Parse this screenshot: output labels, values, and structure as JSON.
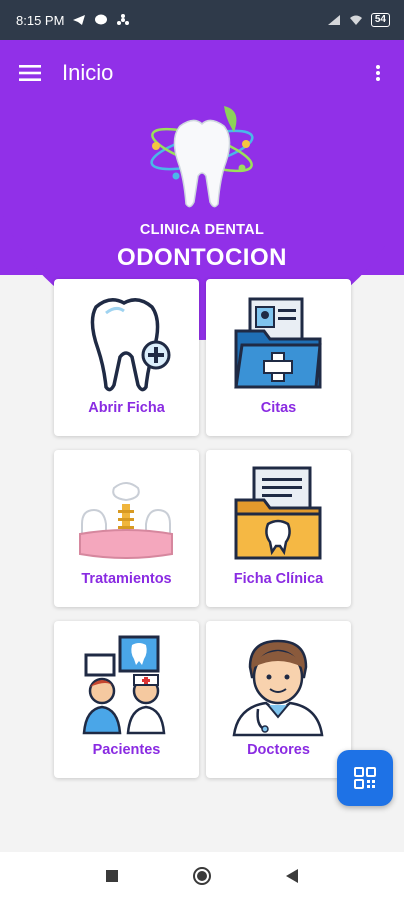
{
  "status_bar": {
    "time": "8:15 PM",
    "battery": "54",
    "icons": [
      "telegram-icon",
      "messenger-icon",
      "fan-icon",
      "signal-icon",
      "wifi-icon",
      "battery-icon"
    ]
  },
  "app_bar": {
    "title": "Inicio",
    "menu_icon": "hamburger-menu-icon",
    "more_icon": "more-vert-icon"
  },
  "clinic": {
    "subtitle": "CLINICA DENTAL",
    "name": "ODONTOCION"
  },
  "menu_cards": [
    {
      "label": "Abrir Ficha",
      "icon": "tooth-add-icon"
    },
    {
      "label": "Citas",
      "icon": "medical-folder-icon"
    },
    {
      "label": "Tratamientos",
      "icon": "dental-implant-icon"
    },
    {
      "label": "Ficha Clínica",
      "icon": "dental-record-folder-icon"
    },
    {
      "label": "Pacientes",
      "icon": "patients-icon"
    },
    {
      "label": "Doctores",
      "icon": "doctor-icon"
    }
  ],
  "fab": {
    "icon": "qr-code-icon"
  },
  "nav": {
    "icons": [
      "recents-square-icon",
      "home-circle-icon",
      "back-triangle-icon"
    ]
  },
  "colors": {
    "primary": "#9130e8",
    "label": "#8a2be2",
    "fab": "#1e72e6",
    "status_bar": "#2f3a4a"
  }
}
